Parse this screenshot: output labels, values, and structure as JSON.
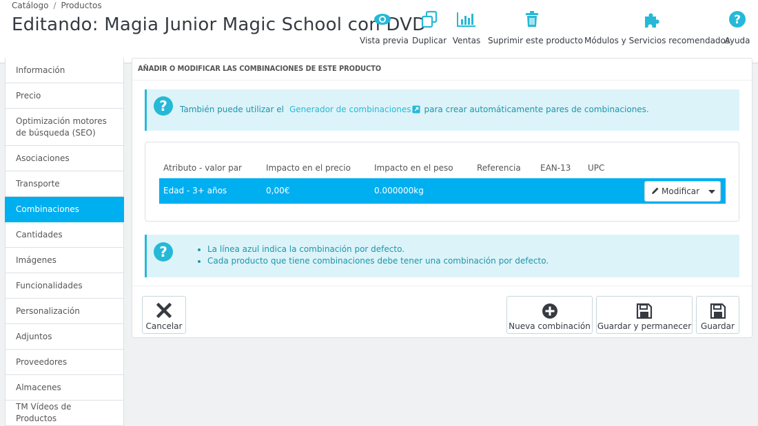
{
  "breadcrumb": {
    "items": [
      "Catálogo",
      "Productos"
    ],
    "separator": "/"
  },
  "page_title": "Editando: Magia Junior Magic School con DVD",
  "toolbar": {
    "preview": {
      "label": "Vista previa",
      "icon": "eye-icon"
    },
    "duplicate": {
      "label": "Duplicar",
      "icon": "duplicate-icon"
    },
    "sales": {
      "label": "Ventas",
      "icon": "bar-chart-icon"
    },
    "delete": {
      "label": "Suprimir este producto",
      "icon": "trash-icon"
    },
    "modules": {
      "label": "Módulos y Servicios recomendados",
      "icon": "puzzle-icon"
    },
    "help": {
      "label": "Ayuda",
      "icon": "question-icon"
    }
  },
  "sidebar": {
    "items": [
      {
        "label": "Información"
      },
      {
        "label": "Precio"
      },
      {
        "label": "Optimización motores de búsqueda (SEO)"
      },
      {
        "label": "Asociaciones"
      },
      {
        "label": "Transporte"
      },
      {
        "label": "Combinaciones",
        "active": true
      },
      {
        "label": "Cantidades"
      },
      {
        "label": "Imágenes"
      },
      {
        "label": "Funcionalidades"
      },
      {
        "label": "Personalización"
      },
      {
        "label": "Adjuntos"
      },
      {
        "label": "Proveedores"
      },
      {
        "label": "Almacenes"
      },
      {
        "label": "TM Vídeos de Productos"
      }
    ]
  },
  "panel": {
    "heading": "AÑADIR O MODIFICAR LAS COMBINACIONES DE ESTE PRODUCTO",
    "info1": {
      "prefix": "También puede utilizar el",
      "link": "Generador de combinaciones",
      "suffix": "para crear automáticamente pares de combinaciones."
    },
    "table": {
      "columns": [
        "Atributo - valor par",
        "Impacto en el precio",
        "Impacto en el peso",
        "Referencia",
        "EAN-13",
        "UPC"
      ],
      "rows": [
        {
          "attribute": "Edad - 3+ años",
          "price_impact": "0,00€",
          "weight_impact": "0.000000kg",
          "reference": "",
          "ean13": "",
          "upc": "",
          "default": true
        }
      ],
      "modify_label": "Modificar"
    },
    "info2": {
      "items": [
        "La línea azul indica la combinación por defecto.",
        "Cada producto que tiene combinaciones debe tener una combinación por defecto."
      ]
    },
    "footer": {
      "cancel": "Cancelar",
      "new": "Nueva combinación",
      "save_stay": "Guardar y permanecer",
      "save": "Guardar"
    }
  },
  "colors": {
    "accent": "#00aff0",
    "info_bg": "#dcf4f9",
    "info_text": "#1e94ab",
    "info_border": "#25b9d7"
  }
}
